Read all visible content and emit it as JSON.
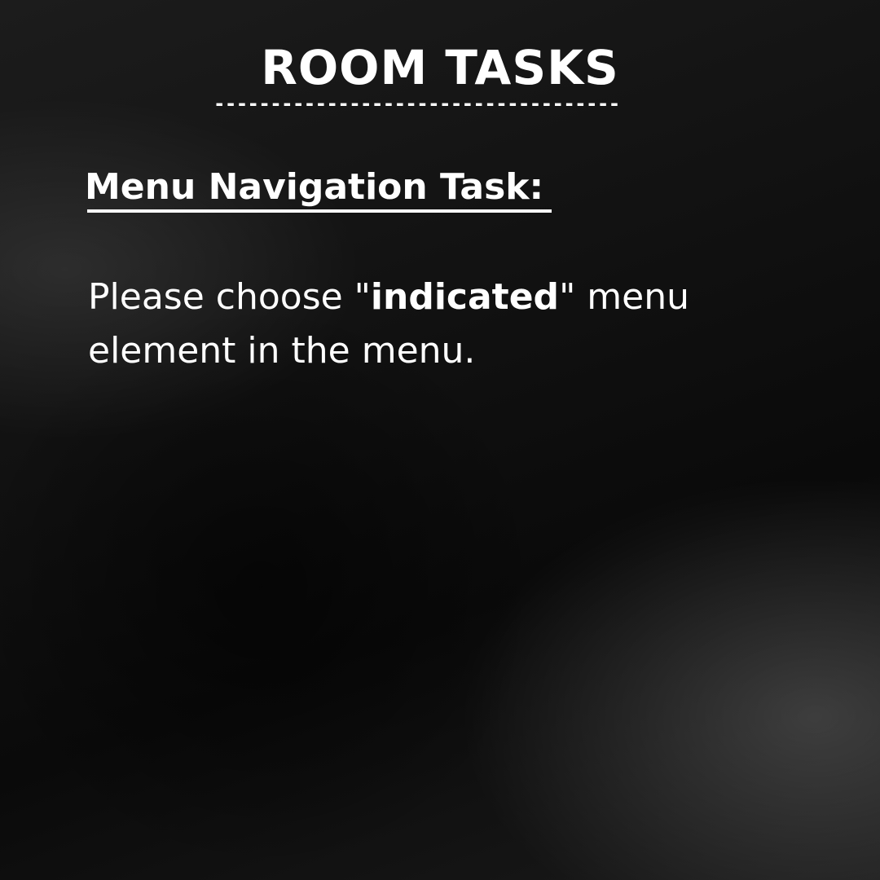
{
  "title": "ROOM TASKS",
  "title_rule": "------------------------------------",
  "section": {
    "heading": "Menu Navigation Task:"
  },
  "instruction": {
    "before": "Please choose \"",
    "emphasis": "indicated",
    "after": "\" menu element in the menu."
  },
  "colors": {
    "text": "#ffffff",
    "background": "#0b0b0b"
  }
}
